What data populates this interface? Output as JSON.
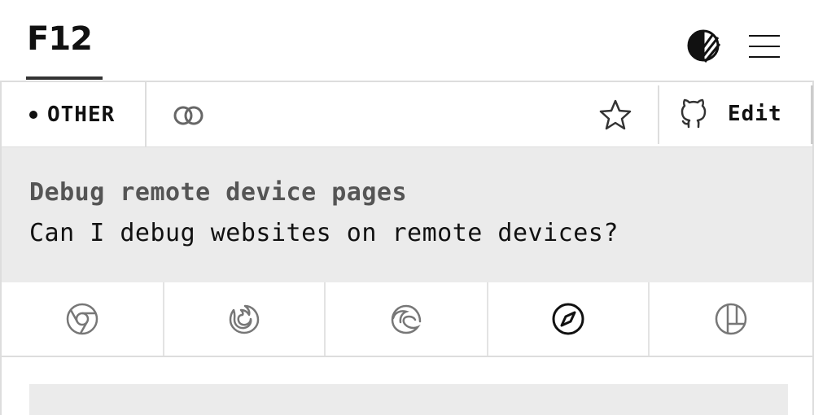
{
  "header": {
    "logo_text": "F12",
    "theme_icon": "contrast-icon",
    "menu_icon": "hamburger-icon"
  },
  "meta": {
    "category_label": "OTHER",
    "link_icon": "link-icon",
    "star_icon": "star-icon",
    "edit_icon": "github-icon",
    "edit_label": "Edit"
  },
  "tip": {
    "title": "Debug remote device pages",
    "question": "Can I debug websites on remote devices?"
  },
  "browsers": [
    {
      "name": "chrome",
      "icon": "chrome-icon",
      "active": false
    },
    {
      "name": "firefox",
      "icon": "firefox-icon",
      "active": false
    },
    {
      "name": "edge",
      "icon": "edge-icon",
      "active": false
    },
    {
      "name": "safari",
      "icon": "safari-icon",
      "active": true
    },
    {
      "name": "polypane",
      "icon": "polypane-icon",
      "active": false
    }
  ],
  "colors": {
    "text": "#111111",
    "muted_text": "#555555",
    "panel_bg": "#ebebeb",
    "border": "#dddddd",
    "inactive_icon": "#777777"
  }
}
